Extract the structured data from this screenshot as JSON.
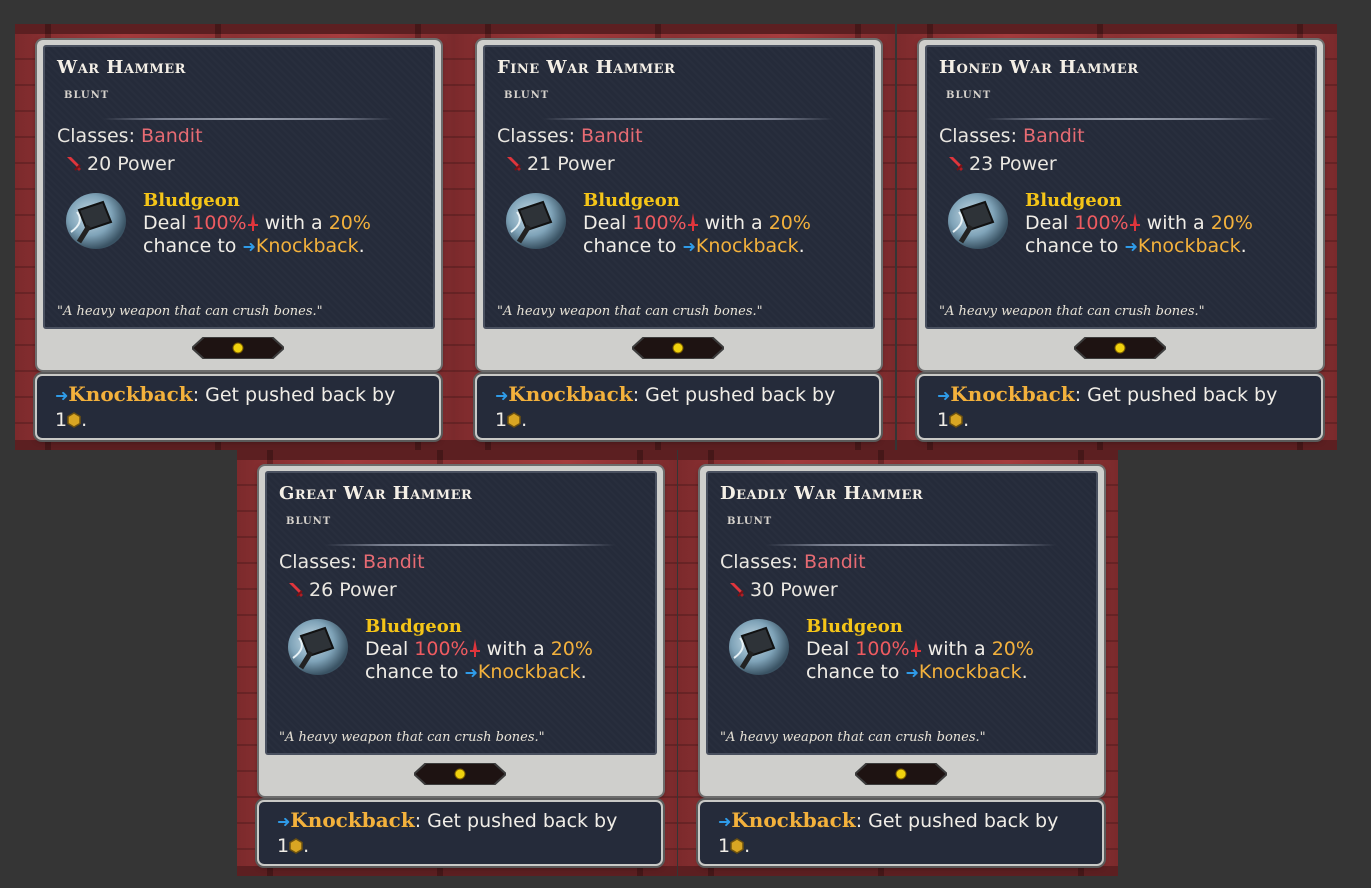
{
  "items": [
    {
      "name": "War Hammer",
      "type": "blunt",
      "classes_label": "Classes:",
      "classes_value": "Bandit",
      "power": "20 Power",
      "skill": "Bludgeon",
      "desc_pre": "Deal",
      "dmg_pct": "100%",
      "desc_mid": "with a",
      "chance": "20%",
      "desc_chance": "chance to",
      "effect": "Knockback",
      "flavor": "\"A heavy weapon that can crush bones.\"",
      "tip_key": "Knockback",
      "tip_text": ": Get pushed back by",
      "tip_num": "1"
    },
    {
      "name": "Fine War Hammer",
      "type": "blunt",
      "classes_label": "Classes:",
      "classes_value": "Bandit",
      "power": "21 Power",
      "skill": "Bludgeon",
      "desc_pre": "Deal",
      "dmg_pct": "100%",
      "desc_mid": "with a",
      "chance": "20%",
      "desc_chance": "chance to",
      "effect": "Knockback",
      "flavor": "\"A heavy weapon that can crush bones.\"",
      "tip_key": "Knockback",
      "tip_text": ": Get pushed back by",
      "tip_num": "1"
    },
    {
      "name": "Honed War Hammer",
      "type": "blunt",
      "classes_label": "Classes:",
      "classes_value": "Bandit",
      "power": "23 Power",
      "skill": "Bludgeon",
      "desc_pre": "Deal",
      "dmg_pct": "100%",
      "desc_mid": "with a",
      "chance": "20%",
      "desc_chance": "chance to",
      "effect": "Knockback",
      "flavor": "\"A heavy weapon that can crush bones.\"",
      "tip_key": "Knockback",
      "tip_text": ": Get pushed back by",
      "tip_num": "1"
    },
    {
      "name": "Great War Hammer",
      "type": "blunt",
      "classes_label": "Classes:",
      "classes_value": "Bandit",
      "power": "26 Power",
      "skill": "Bludgeon",
      "desc_pre": "Deal",
      "dmg_pct": "100%",
      "desc_mid": "with a",
      "chance": "20%",
      "desc_chance": "chance to",
      "effect": "Knockback",
      "flavor": "\"A heavy weapon that can crush bones.\"",
      "tip_key": "Knockback",
      "tip_text": ": Get pushed back by",
      "tip_num": "1"
    },
    {
      "name": "Deadly War Hammer",
      "type": "blunt",
      "classes_label": "Classes:",
      "classes_value": "Bandit",
      "power": "30 Power",
      "skill": "Bludgeon",
      "desc_pre": "Deal",
      "dmg_pct": "100%",
      "desc_mid": "with a",
      "chance": "20%",
      "desc_chance": "chance to",
      "effect": "Knockback",
      "flavor": "\"A heavy weapon that can crush bones.\"",
      "tip_key": "Knockback",
      "tip_text": ": Get pushed back by",
      "tip_num": "1"
    }
  ],
  "colors": {
    "card_bg": "#252b3a",
    "class_red": "#e66b73",
    "skill_gold": "#f5c518",
    "keyword_orange": "#f3b13c",
    "arrow_blue": "#2f9be8",
    "gem_yellow": "#f0d20e"
  },
  "icons": {
    "power": "red-sword-icon",
    "skill": "hammer-skill-icon",
    "damage": "red-dagger-icon",
    "effect": "blue-arrow-icon",
    "tile": "hex-tile-icon"
  }
}
